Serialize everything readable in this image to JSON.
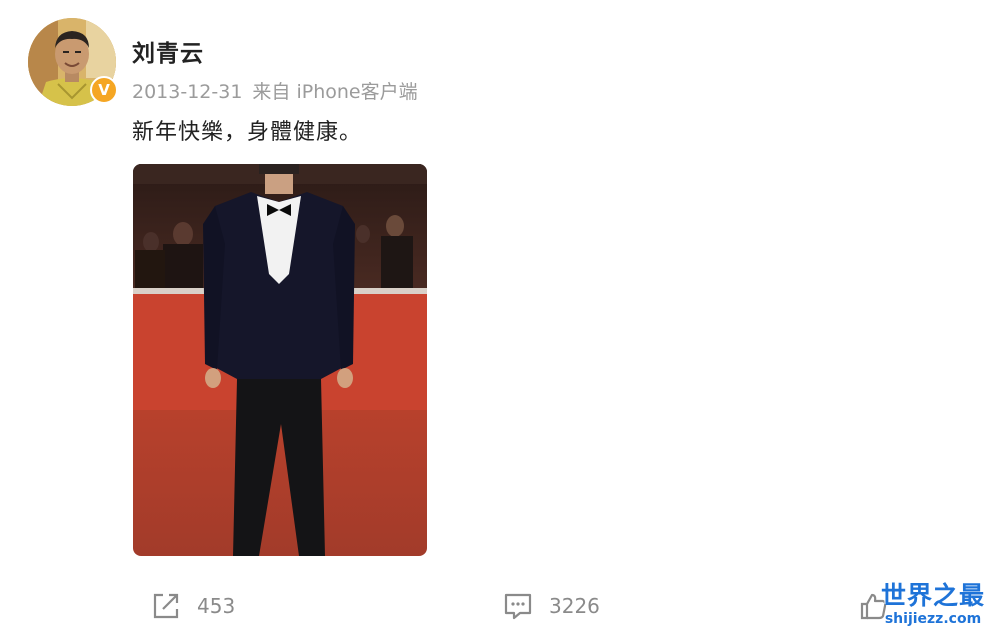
{
  "user": {
    "name": "刘青云",
    "verified_badge": "V",
    "avatar_icon": "avatar-portrait"
  },
  "meta": {
    "date": "2013-12-31",
    "source": "来自 iPhone客户端"
  },
  "post": {
    "text": "新年快樂，身體健康。",
    "image_icon": "red-carpet-photo"
  },
  "actions": {
    "repost_count": "453",
    "comment_count": "3226",
    "like_count": ""
  },
  "watermark": {
    "title": "世界之最",
    "url": "shijiezz.com"
  },
  "colors": {
    "meta_gray": "#9b9b9b",
    "text": "#222222",
    "badge": "#f5a623",
    "watermark": "#1e73d8"
  }
}
